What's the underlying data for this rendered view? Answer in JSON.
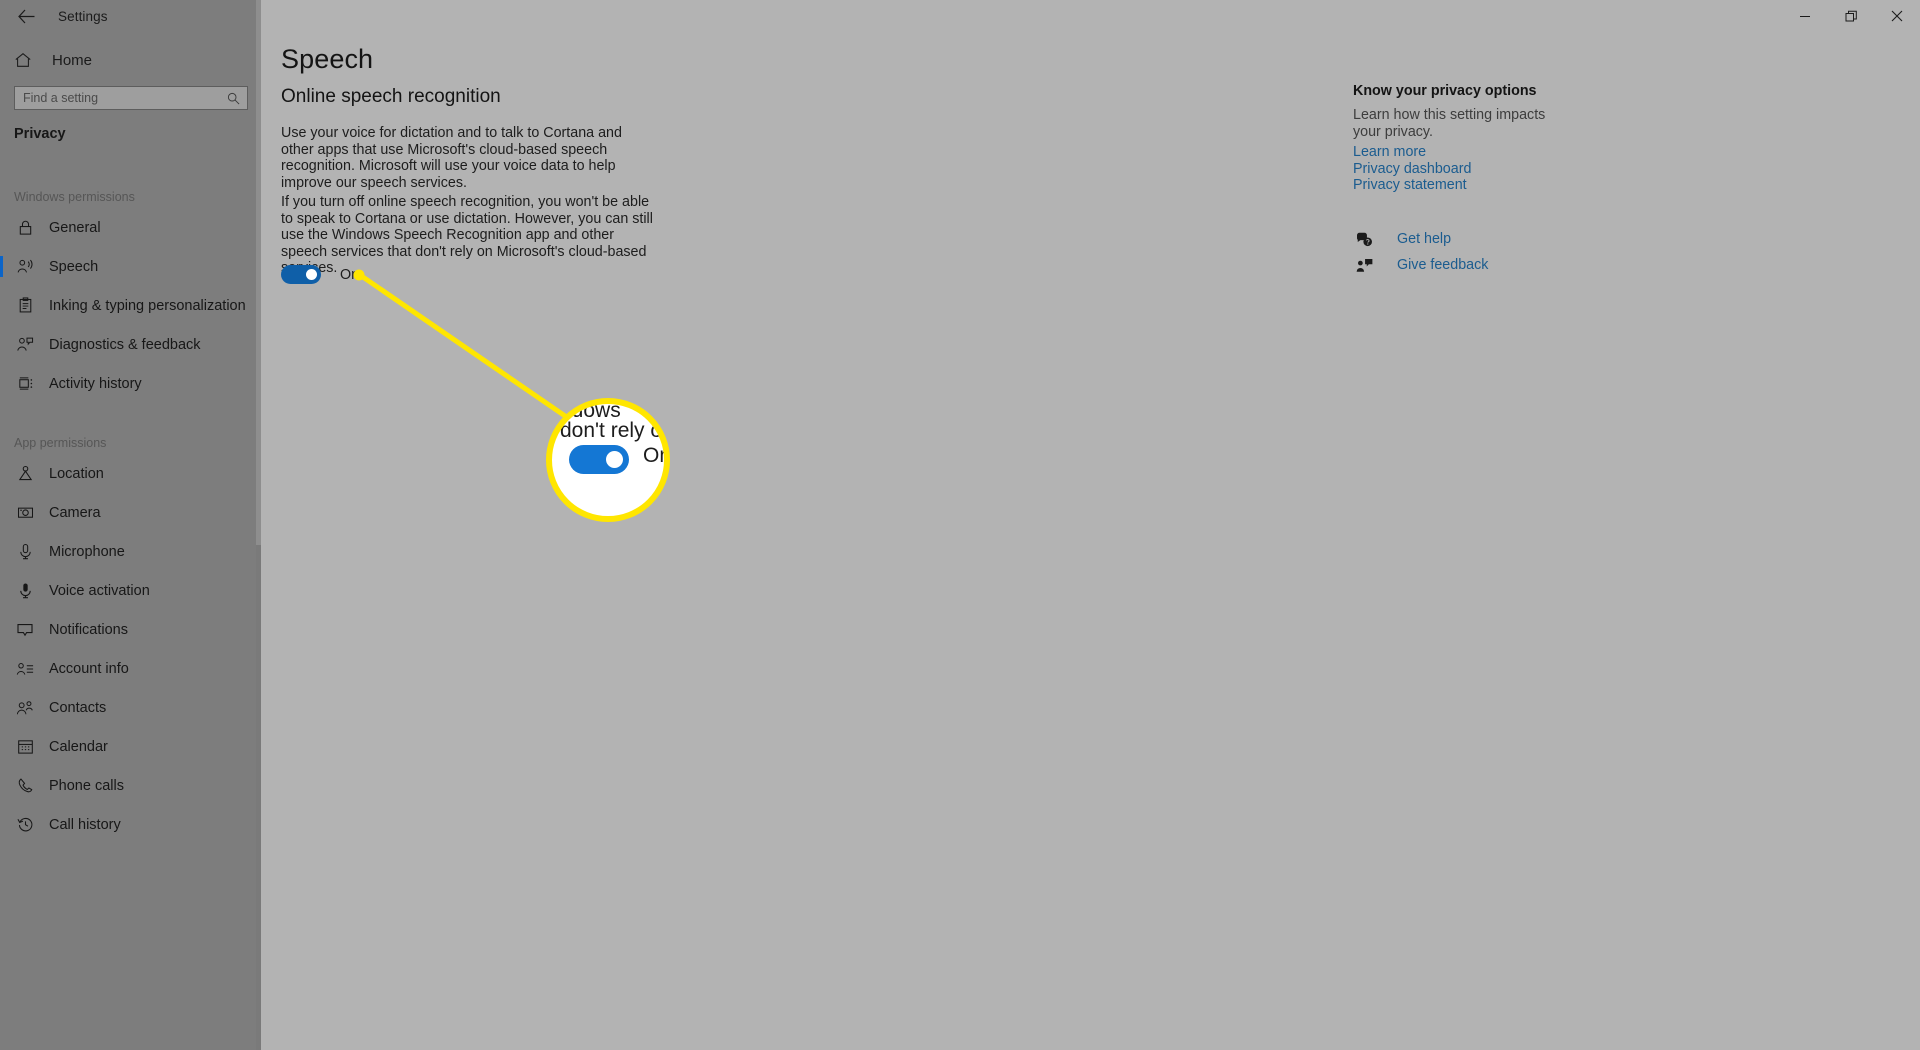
{
  "window": {
    "title": "Settings",
    "back_icon": "back-arrow-icon",
    "controls": {
      "minimize": "minimize-icon",
      "restore": "restore-icon",
      "close": "close-icon"
    }
  },
  "sidebar": {
    "home": {
      "label": "Home",
      "icon": "home-icon"
    },
    "search": {
      "placeholder": "Find a setting",
      "value": "",
      "icon": "search-icon"
    },
    "category": "Privacy",
    "groups": [
      {
        "label": "Windows permissions",
        "items": [
          {
            "label": "General",
            "icon": "lock-icon",
            "selected": false
          },
          {
            "label": "Speech",
            "icon": "speech-person-icon",
            "selected": true
          },
          {
            "label": "Inking & typing personalization",
            "icon": "clipboard-pen-icon",
            "selected": false
          },
          {
            "label": "Diagnostics & feedback",
            "icon": "person-feedback-icon",
            "selected": false
          },
          {
            "label": "Activity history",
            "icon": "activity-history-icon",
            "selected": false
          }
        ]
      },
      {
        "label": "App permissions",
        "items": [
          {
            "label": "Location",
            "icon": "location-pin-icon",
            "selected": false
          },
          {
            "label": "Camera",
            "icon": "camera-icon",
            "selected": false
          },
          {
            "label": "Microphone",
            "icon": "microphone-icon",
            "selected": false
          },
          {
            "label": "Voice activation",
            "icon": "voice-activation-icon",
            "selected": false
          },
          {
            "label": "Notifications",
            "icon": "notification-icon",
            "selected": false
          },
          {
            "label": "Account info",
            "icon": "account-info-icon",
            "selected": false
          },
          {
            "label": "Contacts",
            "icon": "contacts-icon",
            "selected": false
          },
          {
            "label": "Calendar",
            "icon": "calendar-icon",
            "selected": false
          },
          {
            "label": "Phone calls",
            "icon": "phone-icon",
            "selected": false
          },
          {
            "label": "Call history",
            "icon": "call-history-icon",
            "selected": false
          }
        ]
      }
    ]
  },
  "main": {
    "page_title": "Speech",
    "section_heading": "Online speech recognition",
    "paragraph_1": "Use your voice for dictation and to talk to Cortana and other apps that use Microsoft's cloud-based speech recognition. Microsoft will use your voice data to help improve our speech services.",
    "paragraph_2": "If you turn off online speech recognition, you won't be able to speak to Cortana or use dictation. However, you can still use the Windows Speech Recognition app and other speech services that don't rely on Microsoft's cloud-based services.",
    "toggle": {
      "state_label": "On",
      "checked": true
    }
  },
  "right_pane": {
    "title": "Know your privacy options",
    "subtitle": "Learn how this setting impacts your privacy.",
    "links": [
      "Learn more",
      "Privacy dashboard",
      "Privacy statement"
    ],
    "actions": [
      {
        "label": "Get help",
        "icon": "help-chat-icon"
      },
      {
        "label": "Give feedback",
        "icon": "feedback-person-icon"
      }
    ]
  },
  "callout": {
    "magnifier": {
      "clipped_text_top": "ndows",
      "clipped_text_bottom": "don't rely on",
      "toggle_label": "On",
      "ring_color": "#ffe600",
      "leader_line_color": "#ffe600"
    }
  },
  "colors": {
    "accent_blue": "#0f5fa8",
    "link_blue": "#1b5c8f",
    "sidebar_bg": "#7d7d7d",
    "content_bg": "#b3b3b3",
    "highlight_yellow": "#ffe600"
  }
}
